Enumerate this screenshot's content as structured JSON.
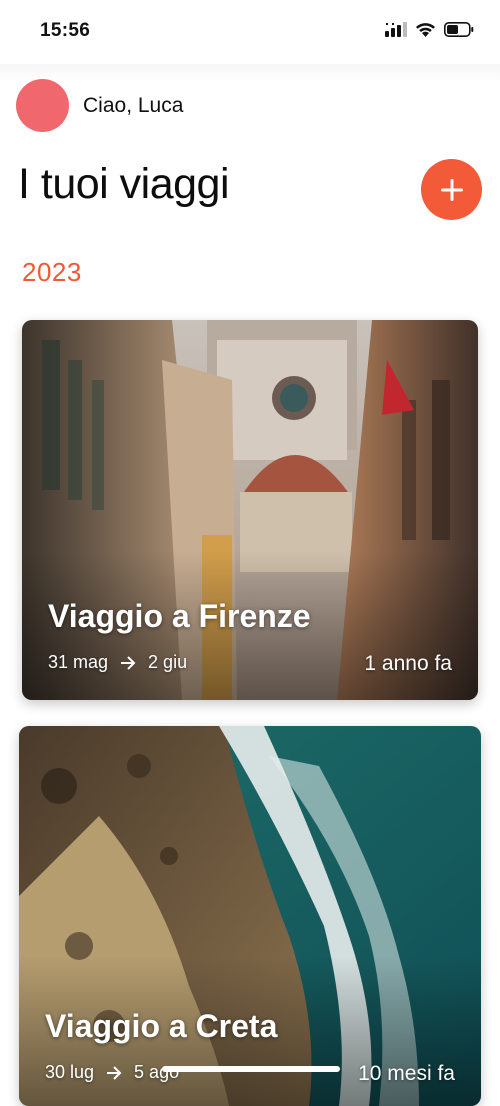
{
  "status_bar": {
    "time": "15:56",
    "icons": [
      "cellular-icon",
      "wifi-icon",
      "battery-icon"
    ]
  },
  "greeting": {
    "text": "Ciao, Luca",
    "avatar_color": "#f0686e"
  },
  "page": {
    "title": "I tuoi viaggi",
    "add_button_icon": "plus-icon",
    "accent_color": "#f25a38"
  },
  "sections": [
    {
      "year": "2023",
      "trips": [
        {
          "title": "Viaggio a Firenze",
          "start": "31 mag",
          "end": "2 giu",
          "arrow_icon": "arrow-right-icon",
          "ago": "1 anno fa"
        },
        {
          "title": "Viaggio a Creta",
          "start": "30 lug",
          "end": "5 ago",
          "arrow_icon": "arrow-right-icon",
          "ago": "10 mesi fa"
        }
      ]
    }
  ]
}
